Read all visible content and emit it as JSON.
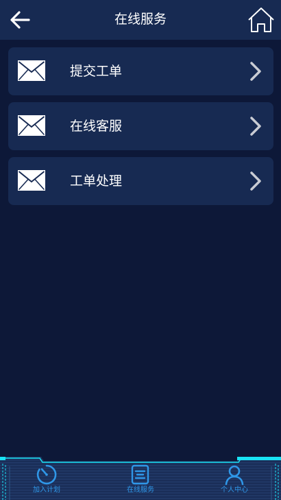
{
  "header": {
    "title": "在线服务"
  },
  "menu": {
    "items": [
      {
        "label": "提交工单",
        "icon": "mail-icon"
      },
      {
        "label": "在线客服",
        "icon": "mail-icon"
      },
      {
        "label": "工单处理",
        "icon": "mail-icon"
      }
    ]
  },
  "tabbar": {
    "items": [
      {
        "label": "加入计划",
        "icon": "timer-icon"
      },
      {
        "label": "在线服务",
        "icon": "service-list-icon"
      },
      {
        "label": "个人中心",
        "icon": "user-icon"
      }
    ]
  },
  "colors": {
    "background": "#0d1838",
    "header": "#172a52",
    "card": "#172a52",
    "tab_accent": "#2f97e8",
    "frame_cyan": "#19e3f6"
  }
}
